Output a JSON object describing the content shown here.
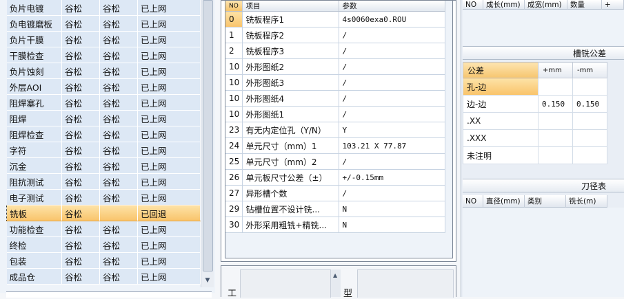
{
  "process_list": {
    "rows": [
      {
        "process": "负片电镀",
        "name1": "谷松",
        "name2": "谷松",
        "status": "已上网"
      },
      {
        "process": "负电镀磨板",
        "name1": "谷松",
        "name2": "谷松",
        "status": "已上网"
      },
      {
        "process": "负片干膜",
        "name1": "谷松",
        "name2": "谷松",
        "status": "已上网"
      },
      {
        "process": "干膜检查",
        "name1": "谷松",
        "name2": "谷松",
        "status": "已上网"
      },
      {
        "process": "负片蚀刻",
        "name1": "谷松",
        "name2": "谷松",
        "status": "已上网"
      },
      {
        "process": "外层AOI",
        "name1": "谷松",
        "name2": "谷松",
        "status": "已上网"
      },
      {
        "process": "阻焊塞孔",
        "name1": "谷松",
        "name2": "谷松",
        "status": "已上网"
      },
      {
        "process": "阻焊",
        "name1": "谷松",
        "name2": "谷松",
        "status": "已上网"
      },
      {
        "process": "阻焊检查",
        "name1": "谷松",
        "name2": "谷松",
        "status": "已上网"
      },
      {
        "process": "字符",
        "name1": "谷松",
        "name2": "谷松",
        "status": "已上网"
      },
      {
        "process": "沉金",
        "name1": "谷松",
        "name2": "谷松",
        "status": "已上网"
      },
      {
        "process": "阻抗测试",
        "name1": "谷松",
        "name2": "谷松",
        "status": "已上网"
      },
      {
        "process": "电子测试",
        "name1": "谷松",
        "name2": "谷松",
        "status": "已上网"
      },
      {
        "process": "铣板",
        "name1": "谷松",
        "name2": "",
        "status": "已回退"
      },
      {
        "process": "功能检查",
        "name1": "谷松",
        "name2": "谷松",
        "status": "已上网"
      },
      {
        "process": "终检",
        "name1": "谷松",
        "name2": "谷松",
        "status": "已上网"
      },
      {
        "process": "包装",
        "name1": "谷松",
        "name2": "谷松",
        "status": "已上网"
      },
      {
        "process": "成品仓",
        "name1": "谷松",
        "name2": "谷松",
        "status": "已上网"
      }
    ],
    "selected_index": 13
  },
  "params": {
    "headers": {
      "no": "NO",
      "item": "项目",
      "value": "参数"
    },
    "rows": [
      {
        "no": "0",
        "item": "铣板程序1",
        "value": "4s0060exa0.ROU"
      },
      {
        "no": "1",
        "item": "铣板程序2",
        "value": "/"
      },
      {
        "no": "2",
        "item": "铣板程序3",
        "value": "/"
      },
      {
        "no": "10",
        "item": "外形图纸2",
        "value": "/"
      },
      {
        "no": "10",
        "item": "外形图纸3",
        "value": "/"
      },
      {
        "no": "10",
        "item": "外形图纸4",
        "value": "/"
      },
      {
        "no": "10",
        "item": "外形图纸1",
        "value": "/"
      },
      {
        "no": "23",
        "item": "有无内定位孔（Y/N）",
        "value": "Y"
      },
      {
        "no": "24",
        "item": "单元尺寸（mm）1",
        "value": "103.21 X 77.87"
      },
      {
        "no": "25",
        "item": "单元尺寸（mm）2",
        "value": "/"
      },
      {
        "no": "26",
        "item": "单元板尺寸公差（±）",
        "value": "+/-0.15mm"
      },
      {
        "no": "27",
        "item": "异形槽个数",
        "value": "/"
      },
      {
        "no": "29",
        "item": "钻槽位置不设计铣...",
        "value": "N"
      },
      {
        "no": "30",
        "item": "外形采用粗铣+精铣...",
        "value": "N"
      }
    ]
  },
  "bottom": {
    "work_label": "工",
    "type_label": "型"
  },
  "top_grid": {
    "headers": [
      "NO",
      "成长(mm)",
      "成宽(mm)",
      "数量",
      "+"
    ]
  },
  "tolerance": {
    "title": "槽铣公差",
    "headers": [
      "公差",
      "+mm",
      "-mm"
    ],
    "rows": [
      {
        "label": "孔-边",
        "plus": "",
        "minus": ""
      },
      {
        "label": "边-边",
        "plus": "0.150",
        "minus": "0.150"
      },
      {
        "label": ".XX",
        "plus": "",
        "minus": ""
      },
      {
        "label": ".XXX",
        "plus": "",
        "minus": ""
      },
      {
        "label": "未注明",
        "plus": "",
        "minus": ""
      }
    ]
  },
  "tools": {
    "title": "刀径表",
    "headers": [
      "NO",
      "直径(mm)",
      "类别",
      "铣长(m)"
    ]
  },
  "colors": {
    "selection": "#f9c36a",
    "row_bg": "#dde8f5",
    "panel_bg": "#eef3f9"
  }
}
